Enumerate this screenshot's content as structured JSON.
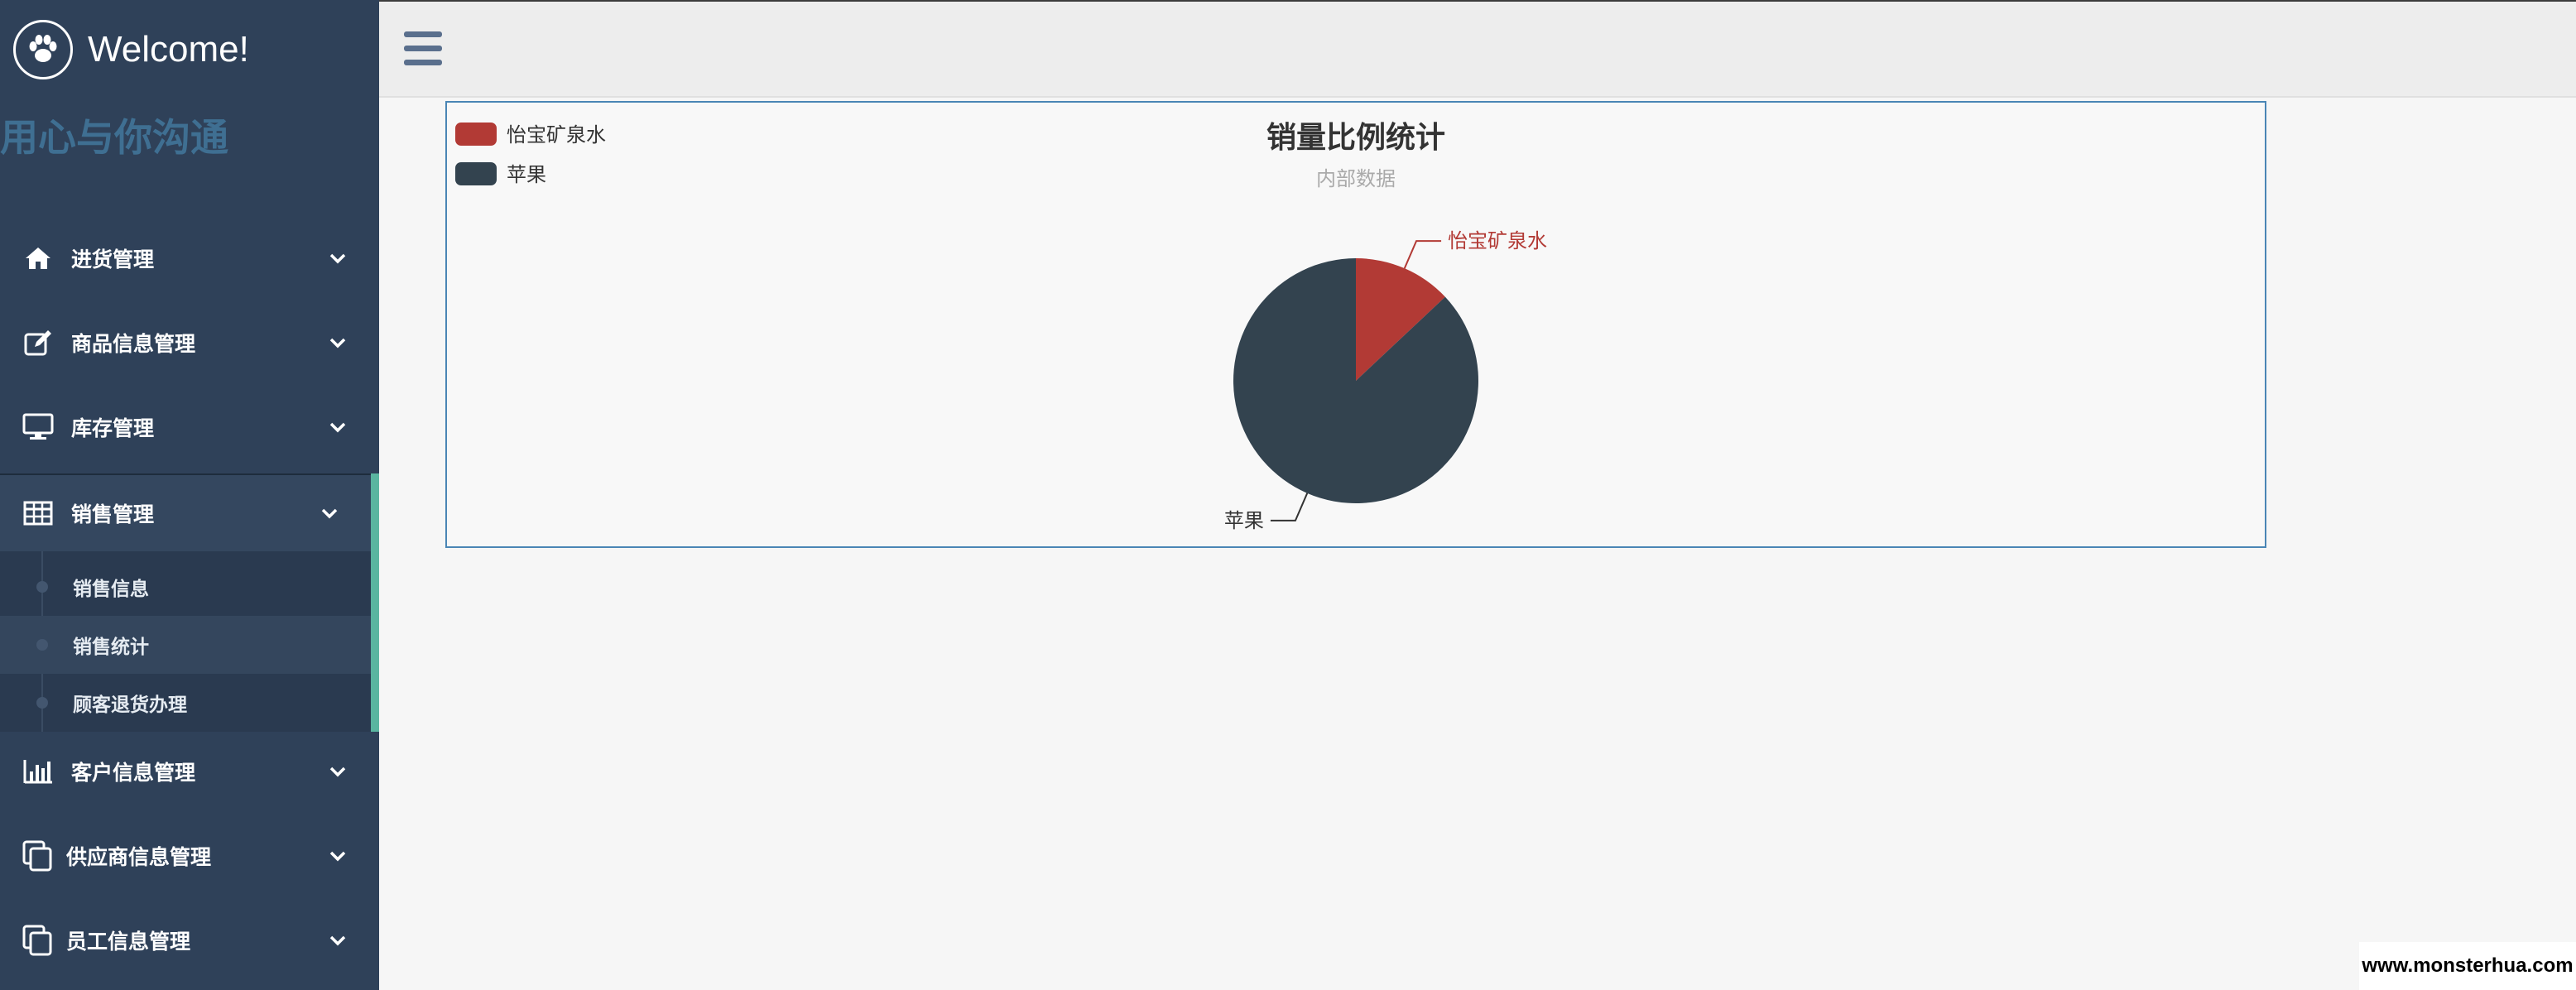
{
  "sidebar": {
    "brand_title": "Welcome!",
    "tagline": "用心与你沟通",
    "menu": [
      {
        "label": "进货管理",
        "icon": "home-icon"
      },
      {
        "label": "商品信息管理",
        "icon": "edit-icon"
      },
      {
        "label": "库存管理",
        "icon": "monitor-icon"
      },
      {
        "label": "销售管理",
        "icon": "table-icon"
      },
      {
        "label": "客户信息管理",
        "icon": "bar-chart-icon"
      },
      {
        "label": "供应商信息管理",
        "icon": "copy-icon"
      },
      {
        "label": "员工信息管理",
        "icon": "copy-icon"
      }
    ],
    "submenu": [
      {
        "label": "销售信息"
      },
      {
        "label": "销售统计"
      },
      {
        "label": "顾客退货办理"
      }
    ],
    "active_menu": "销售管理",
    "selected_submenu": "销售统计"
  },
  "chart_data": {
    "type": "pie",
    "title": "销量比例统计",
    "subtitle": "内部数据",
    "legend_position": "top-left",
    "series": [
      {
        "name": "怡宝矿泉水",
        "value": 13,
        "color": "#b23a35"
      },
      {
        "name": "苹果",
        "value": 87,
        "color": "#33434f"
      }
    ]
  },
  "watermark": "www.monsterhua.com",
  "colors": {
    "sidebar_bg": "#2f4159",
    "accent_green": "#5ab5a0",
    "tagline": "#3f6f92"
  }
}
